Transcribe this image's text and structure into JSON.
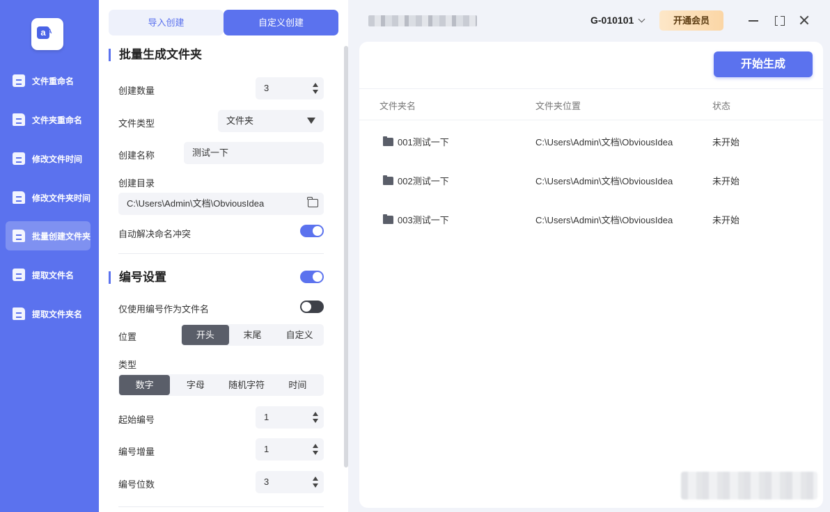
{
  "sidebar": {
    "items": [
      {
        "label": "文件重命名",
        "icon": "file-doc-icon"
      },
      {
        "label": "文件夹重命名",
        "icon": "folder-icon"
      },
      {
        "label": "修改文件时间",
        "icon": "file-clock-icon"
      },
      {
        "label": "修改文件夹时间",
        "icon": "folder-clock-icon"
      },
      {
        "label": "批量创建文件夹",
        "icon": "folder-add-icon",
        "active": true
      },
      {
        "label": "提取文件名",
        "icon": "file-upload-icon"
      },
      {
        "label": "提取文件夹名",
        "icon": "folder-upload-icon"
      }
    ]
  },
  "tabs": {
    "import": "导入创建",
    "custom": "自定义创建"
  },
  "batch": {
    "title": "批量生成文件夹",
    "count_label": "创建数量",
    "count_value": "3",
    "type_label": "文件类型",
    "type_value": "文件夹",
    "name_label": "创建名称",
    "name_value": "测试一下",
    "dir_label": "创建目录",
    "dir_value": "C:\\Users\\Admin\\文档\\ObviousIdea",
    "auto_label": "自动解决命名冲突",
    "auto_on": true
  },
  "numbering": {
    "title": "编号设置",
    "enabled": true,
    "only_label": "仅使用编号作为文件名",
    "only_on": false,
    "position_label": "位置",
    "position_options": [
      "开头",
      "末尾",
      "自定义"
    ],
    "position_selected": "开头",
    "type_label": "类型",
    "type_options": [
      "数字",
      "字母",
      "随机字符",
      "时间"
    ],
    "type_selected": "数字",
    "start_label": "起始编号",
    "start_value": "1",
    "step_label": "编号增量",
    "step_value": "1",
    "digits_label": "编号位数",
    "digits_value": "3"
  },
  "header": {
    "user_id": "G-010101",
    "vip_label": "开通会员"
  },
  "main": {
    "start_button": "开始生成",
    "columns": [
      "文件夹名",
      "文件夹位置",
      "状态"
    ],
    "rows": [
      {
        "name": "001测试一下",
        "path": "C:\\Users\\Admin\\文档\\ObviousIdea",
        "status": "未开始"
      },
      {
        "name": "002测试一下",
        "path": "C:\\Users\\Admin\\文档\\ObviousIdea",
        "status": "未开始"
      },
      {
        "name": "003测试一下",
        "path": "C:\\Users\\Admin\\文档\\ObviousIdea",
        "status": "未开始"
      }
    ]
  },
  "colors": {
    "accent": "#5b72ee",
    "selected_segment": "#5a5e69",
    "vip": "#fbd6a6"
  }
}
